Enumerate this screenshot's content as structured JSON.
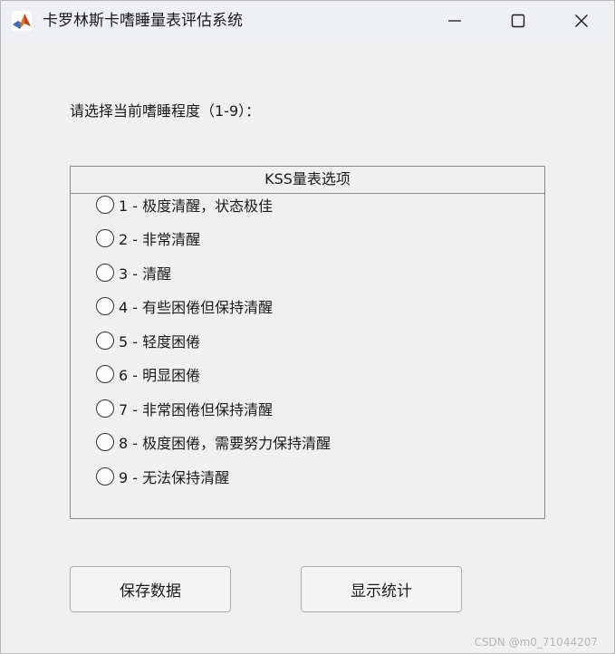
{
  "window": {
    "title": "卡罗林斯卡嗜睡量表评估系统",
    "controls": {
      "minimize_icon": "minimize-icon",
      "maximize_icon": "maximize-icon",
      "close_icon": "close-icon"
    },
    "app_icon": "matlab-icon"
  },
  "prompt": "请选择当前嗜睡程度（1-9）：",
  "panel": {
    "title": "KSS量表选项",
    "options": [
      {
        "label": "1 - 极度清醒，状态极佳",
        "selected": false
      },
      {
        "label": "2 - 非常清醒",
        "selected": false
      },
      {
        "label": "3 - 清醒",
        "selected": false
      },
      {
        "label": "4 - 有些困倦但保持清醒",
        "selected": false
      },
      {
        "label": "5 - 轻度困倦",
        "selected": false
      },
      {
        "label": "6 - 明显困倦",
        "selected": false
      },
      {
        "label": "7 - 非常困倦但保持清醒",
        "selected": false
      },
      {
        "label": "8 - 极度困倦，需要努力保持清醒",
        "selected": false
      },
      {
        "label": "9 - 无法保持清醒",
        "selected": false
      }
    ]
  },
  "buttons": {
    "save": "保存数据",
    "stats": "显示统计"
  },
  "watermark": "CSDN @m0_71044207",
  "colors": {
    "window_bg": "#f0f0f0",
    "border": "#8a8a8a",
    "text": "#1a1a1a"
  }
}
